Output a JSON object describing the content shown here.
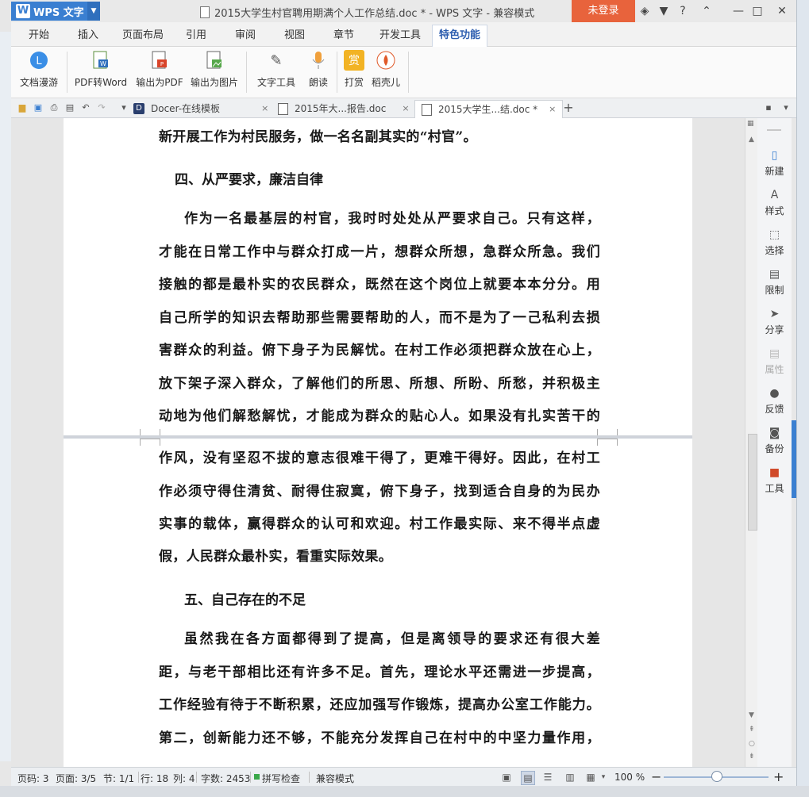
{
  "app": {
    "name": "WPS 文字",
    "window_title": "2015大学生村官聘用期满个人工作总结.doc * - WPS 文字 - 兼容模式",
    "login_label": "未登录"
  },
  "menu_tabs": [
    "开始",
    "插入",
    "页面布局",
    "引用",
    "审阅",
    "视图",
    "章节",
    "开发工具",
    "特色功能"
  ],
  "active_tab": "特色功能",
  "ribbon": {
    "items": [
      "文档漫游",
      "PDF转Word",
      "输出为PDF",
      "输出为图片",
      "文字工具",
      "朗读",
      "打赏",
      "稻壳儿"
    ]
  },
  "doc_tabs": [
    {
      "label": "Docer-在线模板",
      "close": "×"
    },
    {
      "label": "2015年大...报告.doc",
      "close": "×"
    },
    {
      "label": "2015大学生...结.doc *",
      "close": "×"
    }
  ],
  "new_tab_symbol": "+",
  "document": {
    "page1_lines": [
      "新开展工作为村民服务，做一名名副其实的“村官”。",
      "四、从严要求，廉洁自律",
      "作为一名最基层的村官，我时时处处从严要求自己。只有这样，",
      "才能在日常工作中与群众打成一片，想群众所想，急群众所急。我们",
      "接触的都是最朴实的农民群众，既然在这个岗位上就要本本分分。用",
      "自己所学的知识去帮助那些需要帮助的人，而不是为了一己私利去损",
      "害群众的利益。俯下身子为民解忧。在村工作必须把群众放在心上，",
      "放下架子深入群众，了解他们的所思、所想、所盼、所愁，并积极主",
      "动地为他们解愁解忧，才能成为群众的贴心人。如果没有扎实苦干的"
    ],
    "page2_lines": [
      "作风，没有坚忍不拔的意志很难干得了，更难干得好。因此，在村工",
      "作必须守得住清贫、耐得住寂寞，俯下身子，找到适合自身的为民办",
      "实事的载体，赢得群众的认可和欢迎。村工作最实际、来不得半点虚",
      "假，人民群众最朴实，看重实际效果。",
      "五、自己存在的不足",
      "虽然我在各方面都得到了提高，但是离领导的要求还有很大差",
      "距，与老干部相比还有许多不足。首先，理论水平还需进一步提高，",
      "工作经验有待于不断积累，还应加强写作锻炼，提高办公室工作能力。",
      "第二，创新能力还不够，不能充分发挥自己在村中的中坚力量作用，"
    ]
  },
  "task_pane": [
    "新建",
    "样式",
    "选择",
    "限制",
    "分享",
    "属性",
    "反馈",
    "备份",
    "工具"
  ],
  "status": {
    "page_code": "页码: 3",
    "pages": "页面: 3/5",
    "section": "节: 1/1",
    "row": "行: 18",
    "col": "列: 4",
    "words": "字数: 2453",
    "spell": "拼写检查",
    "compat": "兼容模式",
    "zoom": "100 %",
    "zoom_minus": "−",
    "zoom_plus": "+"
  },
  "colors": {
    "accent": "#3a7fd1",
    "login": "#e8633c",
    "active_tab_text": "#2f5fb0"
  }
}
